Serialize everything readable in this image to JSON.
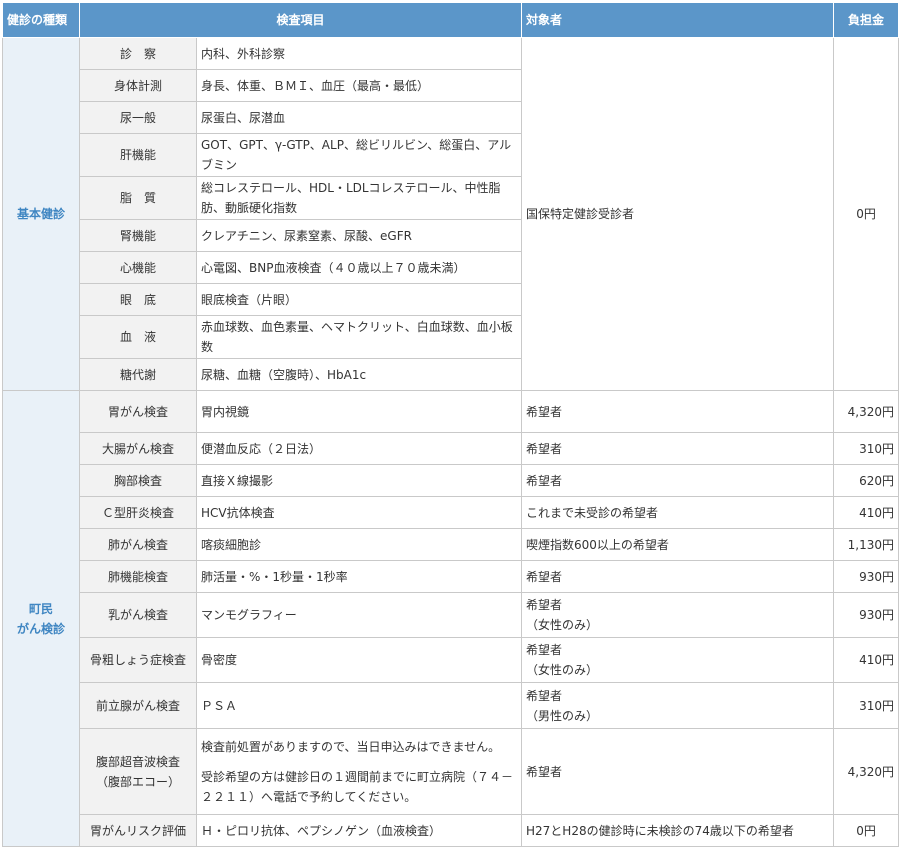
{
  "header": {
    "kind": "健診の種類",
    "item": "検査項目",
    "target": "対象者",
    "cost": "負担金"
  },
  "basic": {
    "label": "基本健診",
    "target": "国保特定健診受診者",
    "cost": "0円",
    "rows": [
      {
        "name": "診　察",
        "detail": "内科、外科診察"
      },
      {
        "name": "身体計測",
        "detail": "身長、体重、ＢＭＩ、血圧（最高・最低）"
      },
      {
        "name": "尿一般",
        "detail": "尿蛋白、尿潜血"
      },
      {
        "name": "肝機能",
        "detail": "GOT、GPT、γ-GTP、ALP、総ビリルビン、総蛋白、アルブミン"
      },
      {
        "name": "脂　質",
        "detail": "総コレステロール、HDL・LDLコレステロール、中性脂肪、動脈硬化指数"
      },
      {
        "name": "腎機能",
        "detail": "クレアチニン、尿素窒素、尿酸、eGFR"
      },
      {
        "name": "心機能",
        "detail": "心電図、BNP血液検査（４０歳以上７０歳未満）"
      },
      {
        "name": "眼　底",
        "detail": "眼底検査（片眼）"
      },
      {
        "name": "血　液",
        "detail": "赤血球数、血色素量、ヘマトクリット、白血球数、血小板数"
      },
      {
        "name": "糖代謝",
        "detail": "尿糖、血糖（空腹時）、HbA1c"
      }
    ]
  },
  "cancer": {
    "label_line1": "町民",
    "label_line2": "がん検診",
    "rows": [
      {
        "name": "胃がん検査",
        "detail": "胃内視鏡",
        "target": "希望者",
        "cost": "4,320円"
      },
      {
        "name": "大腸がん検査",
        "detail": "便潜血反応（２日法）",
        "target": "希望者",
        "cost": "310円"
      },
      {
        "name": "胸部検査",
        "detail": "直接Ｘ線撮影",
        "target": "希望者",
        "cost": "620円"
      },
      {
        "name": "Ｃ型肝炎検査",
        "detail": "HCV抗体検査",
        "target": "これまで未受診の希望者",
        "cost": "410円"
      },
      {
        "name": "肺がん検査",
        "detail": "喀痰細胞診",
        "target": "喫煙指数600以上の希望者",
        "cost": "1,130円"
      },
      {
        "name": "肺機能検査",
        "detail": "肺活量・%・1秒量・1秒率",
        "target": "希望者",
        "cost": "930円"
      },
      {
        "name": "乳がん検査",
        "detail": "マンモグラフィー",
        "target": "希望者",
        "target_note": "（女性のみ）",
        "cost": "930円"
      },
      {
        "name": "骨粗しょう症検査",
        "detail": "骨密度",
        "target": "希望者",
        "target_note": "（女性のみ）",
        "cost": "410円"
      },
      {
        "name": "前立腺がん検査",
        "detail": "ＰＳＡ",
        "target": "希望者",
        "target_note": "（男性のみ）",
        "cost": "310円"
      },
      {
        "name": "腹部超音波検査",
        "name_note": "（腹部エコー）",
        "detail": "検査前処置がありますので、当日申込みはできません。",
        "detail_2": "受診希望の方は健診日の１週間前までに町立病院（７４－２２１１）へ電話で予約してください。",
        "target": "希望者",
        "cost": "4,320円"
      },
      {
        "name": "胃がんリスク評価",
        "detail": "Ｈ・ピロリ抗体、ペプシノゲン（血液検査）",
        "target": "H27とH28の健診時に未検診の74歳以下の希望者",
        "cost": "0円"
      }
    ]
  }
}
